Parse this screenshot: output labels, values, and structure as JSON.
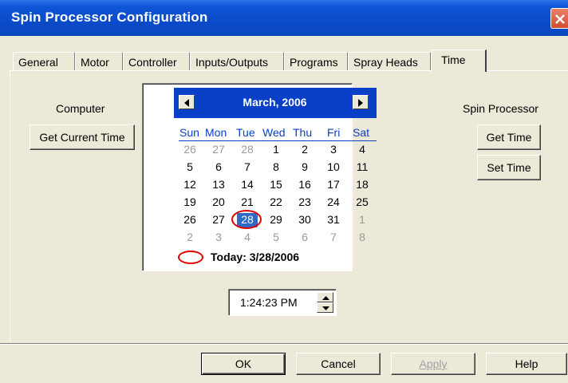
{
  "window": {
    "title": "Spin Processor Configuration"
  },
  "tabs": [
    {
      "label": "General"
    },
    {
      "label": "Motor"
    },
    {
      "label": "Controller"
    },
    {
      "label": "Inputs/Outputs"
    },
    {
      "label": "Programs"
    },
    {
      "label": "Spray Heads"
    },
    {
      "label": "Time",
      "active": true
    }
  ],
  "computer": {
    "heading": "Computer",
    "get_current_time": "Get Current Time"
  },
  "spin_processor": {
    "heading": "Spin Processor",
    "get_time": "Get Time",
    "set_time": "Set Time"
  },
  "calendar": {
    "month_title": "March, 2006",
    "weekdays": [
      "Sun",
      "Mon",
      "Tue",
      "Wed",
      "Thu",
      "Fri",
      "Sat"
    ],
    "weeks": [
      [
        "26",
        "27",
        "28",
        "1",
        "2",
        "3",
        "4"
      ],
      [
        "5",
        "6",
        "7",
        "8",
        "9",
        "10",
        "11"
      ],
      [
        "12",
        "13",
        "14",
        "15",
        "16",
        "17",
        "18"
      ],
      [
        "19",
        "20",
        "21",
        "22",
        "23",
        "24",
        "25"
      ],
      [
        "26",
        "27",
        "28",
        "29",
        "30",
        "31",
        "1"
      ],
      [
        "2",
        "3",
        "4",
        "5",
        "6",
        "7",
        "8"
      ]
    ],
    "selected_day": "28",
    "today_label": "Today: 3/28/2006"
  },
  "time_picker": {
    "value": "1:24:23 PM"
  },
  "buttons": {
    "ok": "OK",
    "cancel": "Cancel",
    "apply": "Apply",
    "help": "Help"
  },
  "colors": {
    "title_bar": "#0a4bc9",
    "calendar_header": "#0a3fc8",
    "today_marker": "#e00000",
    "selection": "#316ac5"
  }
}
